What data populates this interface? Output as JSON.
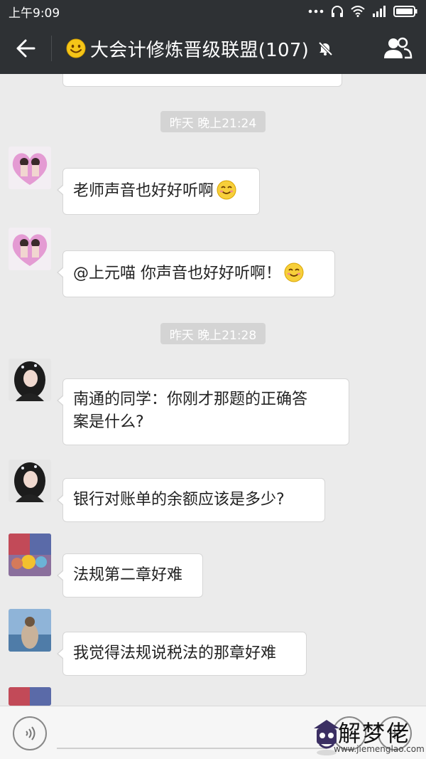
{
  "status_bar": {
    "time": "上午9:09",
    "icons": [
      "dots-icon",
      "headset-icon",
      "wifi-icon",
      "signal-icon",
      "battery-icon"
    ]
  },
  "header": {
    "title": "大会计修炼晋级联盟(107)",
    "title_emoji": "smiley-icon",
    "icons": [
      "back-arrow-icon",
      "mute-bell-icon",
      "members-icon"
    ],
    "bg_color": "#2e3134"
  },
  "chat": {
    "timestamps": [
      "昨天 晚上21:24",
      "昨天 晚上21:28"
    ],
    "messages": [
      {
        "text": "老师声音也好好听啊",
        "emoji": "smile-emoji"
      },
      {
        "text": "@上元喵 你声音也好好听啊！",
        "emoji": "smile-emoji"
      },
      {
        "text": "南通的同学：你刚才那题的正确答",
        "text2": "案是什么?"
      },
      {
        "text": "银行对账单的余额应该是多少?"
      },
      {
        "text": "法规第二章好难"
      },
      {
        "text": "我觉得法规说税法的那章好难"
      }
    ]
  },
  "input_bar": {
    "icons": [
      "voice-icon",
      "emoji-icon",
      "plus-icon"
    ]
  },
  "watermark": {
    "text": "解梦佬",
    "url": "www.jiemenglao.com"
  }
}
